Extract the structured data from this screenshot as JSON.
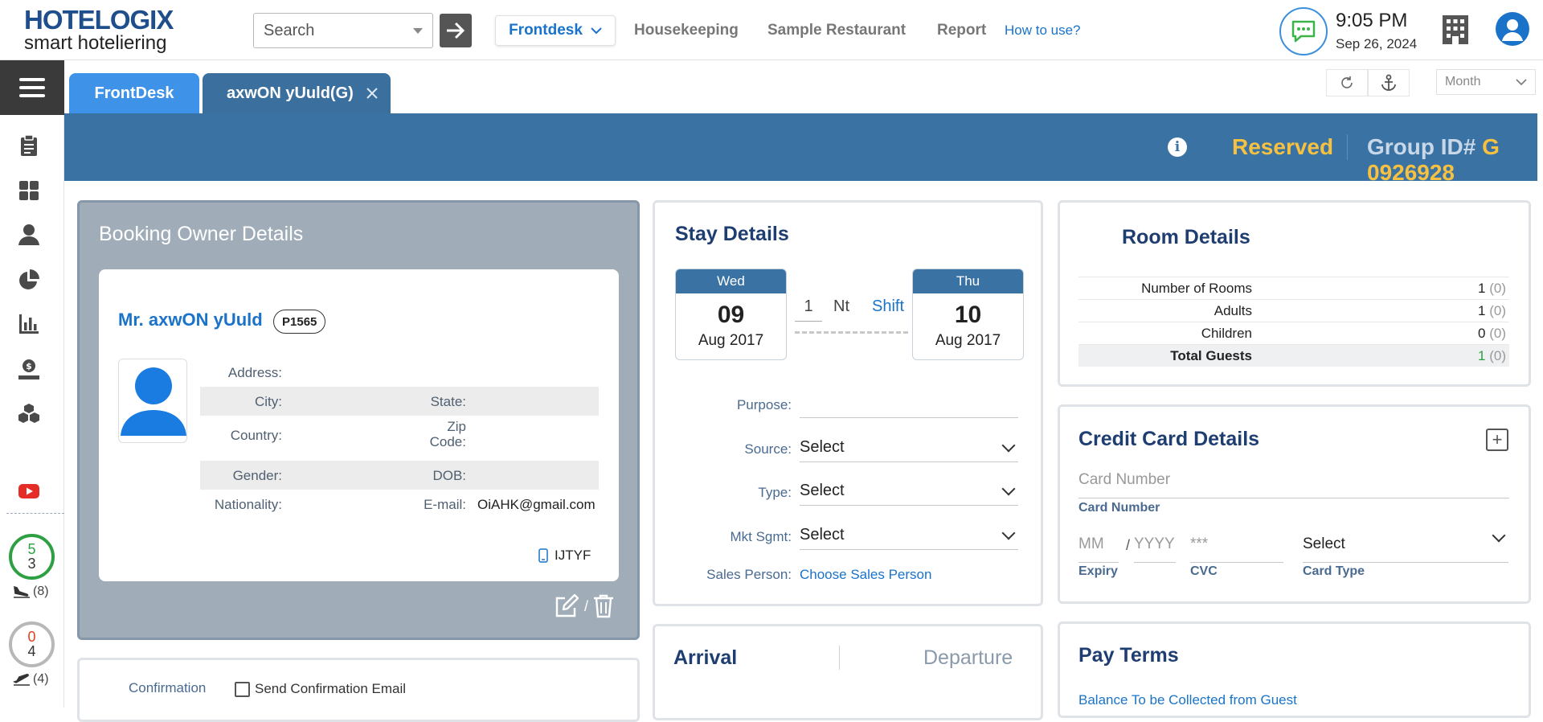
{
  "header": {
    "logo_line1": "HOTELOGIX",
    "logo_line2": "smart hoteliering",
    "search_placeholder": "Search",
    "nav_active": "Frontdesk",
    "nav_items": [
      "Housekeeping",
      "Sample Restaurant",
      "Report"
    ],
    "how_to": "How to use?",
    "time": "9:05 PM",
    "date": "Sep 26, 2024"
  },
  "sidebar": {
    "icons": [
      "clipboard-icon",
      "dashboard-icon",
      "guest-icon",
      "pie-chart-icon",
      "bar-chart-icon",
      "cash-icon",
      "cubes-icon",
      "youtube-icon"
    ],
    "arrivals": {
      "done": "5",
      "total": "3",
      "count": "(8)"
    },
    "departures": {
      "done": "0",
      "total": "4",
      "count": "(4)"
    }
  },
  "tabs": {
    "tab1": "FrontDesk",
    "tab2": "axwON yUuld(G)",
    "view_select": "Month"
  },
  "banner": {
    "status": "Reserved",
    "group_label": "Group ID#",
    "group_id": "G 0926928"
  },
  "owner": {
    "title": "Booking Owner Details",
    "name": "Mr. axwON yUuld",
    "badge": "P1565",
    "address_label": "Address:",
    "city_label": "City:",
    "state_label": "State:",
    "country_label": "Country:",
    "zip_label_1": "Zip",
    "zip_label_2": "Code:",
    "gender_label": "Gender:",
    "dob_label": "DOB:",
    "nationality_label": "Nationality:",
    "email_label": "E-mail:",
    "email": "OiAHK@gmail.com",
    "phone": "IJTYF",
    "slash": "/"
  },
  "stay": {
    "title": "Stay Details",
    "checkin": {
      "day": "Wed",
      "date": "09",
      "month": "Aug 2017"
    },
    "checkout": {
      "day": "Thu",
      "date": "10",
      "month": "Aug 2017"
    },
    "nights": "1",
    "nights_label": "Nt",
    "shift": "Shift",
    "purpose_label": "Purpose:",
    "source_label": "Source:",
    "source_value": "Select",
    "type_label": "Type:",
    "type_value": "Select",
    "mkt_label": "Mkt Sgmt:",
    "mkt_value": "Select",
    "sales_label": "Sales Person:",
    "sales_value": "Choose Sales Person"
  },
  "room": {
    "title": "Room Details",
    "rows": [
      {
        "label": "Number of Rooms",
        "value": "1",
        "extra": "(0)"
      },
      {
        "label": "Adults",
        "value": "1",
        "extra": "(0)"
      },
      {
        "label": "Children",
        "value": "0",
        "extra": "(0)"
      },
      {
        "label": "Total Guests",
        "value": "1",
        "extra": "(0)"
      }
    ]
  },
  "credit": {
    "title": "Credit Card Details",
    "card_number_placeholder": "Card Number",
    "card_number_label": "Card Number",
    "mm_placeholder": "MM",
    "yyyy_placeholder": "YYYY",
    "cvc_placeholder": "***",
    "card_type_value": "Select",
    "expiry_label": "Expiry",
    "cvc_label": "CVC",
    "card_type_label": "Card Type"
  },
  "arrival": {
    "title": "Arrival",
    "departure": "Departure"
  },
  "payterms": {
    "title": "Pay Terms",
    "link": "Balance To be Collected from Guest"
  },
  "confirmation": {
    "label": "Confirmation",
    "checkbox_label": "Send Confirmation Email"
  },
  "colors": {
    "accent": "#1a73c9",
    "banner": "#3a73a3",
    "status": "#f6c140"
  }
}
